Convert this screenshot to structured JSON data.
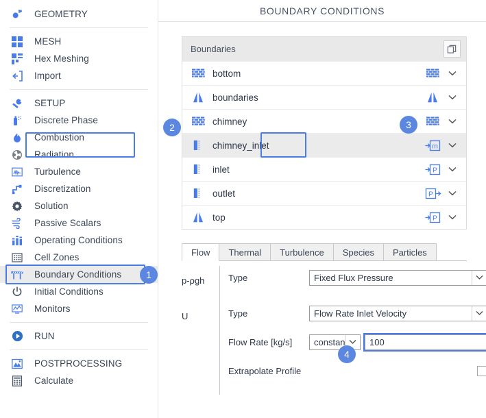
{
  "header": {
    "title": "BOUNDARY CONDITIONS"
  },
  "colors": {
    "accent": "#4a7ce8",
    "badge": "#5b87e0",
    "icon_blue": "#4a7ce8",
    "icon_gray": "#6b7280",
    "panel_header": "#e9e9e9",
    "row_selected": "#ebebeb",
    "text": "#2d3748"
  },
  "sidebar": {
    "groups": [
      {
        "items": [
          {
            "label": "GEOMETRY",
            "icon": "geometry-icon",
            "selected": false
          }
        ]
      },
      {
        "items": [
          {
            "label": "MESH",
            "icon": "mesh-icon",
            "selected": false
          },
          {
            "label": "Hex Meshing",
            "icon": "hex-meshing-icon",
            "selected": false
          },
          {
            "label": "Import",
            "icon": "import-icon",
            "selected": false
          }
        ]
      },
      {
        "items": [
          {
            "label": "SETUP",
            "icon": "wrench-icon",
            "selected": false
          },
          {
            "label": "Discrete Phase",
            "icon": "spray-icon",
            "selected": false
          },
          {
            "label": "Combustion",
            "icon": "flame-icon",
            "selected": false
          },
          {
            "label": "Radiation",
            "icon": "radiation-icon",
            "selected": false
          },
          {
            "label": "Turbulence",
            "icon": "turbulence-icon",
            "selected": false
          },
          {
            "label": "Discretization",
            "icon": "discretization-icon",
            "selected": false
          },
          {
            "label": "Solution",
            "icon": "gear-icon",
            "selected": false
          },
          {
            "label": "Passive Scalars",
            "icon": "wind-icon",
            "selected": false
          },
          {
            "label": "Operating Conditions",
            "icon": "bar-chart-icon",
            "selected": false
          },
          {
            "label": "Cell Zones",
            "icon": "cell-zones-icon",
            "selected": false
          },
          {
            "label": "Boundary Conditions",
            "icon": "boundary-conditions-icon",
            "selected": true
          },
          {
            "label": "Initial Conditions",
            "icon": "power-icon",
            "selected": false
          },
          {
            "label": "Monitors",
            "icon": "monitor-icon",
            "selected": false
          }
        ]
      },
      {
        "items": [
          {
            "label": "RUN",
            "icon": "play-icon",
            "selected": false
          }
        ]
      },
      {
        "items": [
          {
            "label": "POSTPROCESSING",
            "icon": "postprocessing-icon",
            "selected": false
          },
          {
            "label": "Calculate",
            "icon": "calculator-icon",
            "selected": false
          }
        ]
      }
    ]
  },
  "boundaries_panel": {
    "title": "Boundaries",
    "copy_button_icon": "copy-icon",
    "rows": [
      {
        "name": "bottom",
        "left_icon": "wall-brick-icon",
        "type_icon": "wall-brick-icon",
        "chevron": "chevron-down-icon",
        "selected": false
      },
      {
        "name": "boundaries",
        "left_icon": "symmetry-icon",
        "type_icon": "symmetry-icon",
        "chevron": "chevron-down-icon",
        "selected": false
      },
      {
        "name": "chimney",
        "left_icon": "wall-brick-icon",
        "type_icon": "wall-brick-icon",
        "chevron": "chevron-down-icon",
        "selected": false
      },
      {
        "name": "chimney_inlet",
        "left_icon": "patch-icon",
        "type_icon": "mass-flow-in-icon",
        "chevron": "chevron-down-icon",
        "selected": true
      },
      {
        "name": "inlet",
        "left_icon": "patch-icon",
        "type_icon": "pressure-in-icon",
        "chevron": "chevron-down-icon",
        "selected": false
      },
      {
        "name": "outlet",
        "left_icon": "patch-icon",
        "type_icon": "pressure-out-icon",
        "chevron": "chevron-down-icon",
        "selected": false
      },
      {
        "name": "top",
        "left_icon": "symmetry-icon",
        "type_icon": "pressure-in-icon",
        "chevron": "chevron-down-icon",
        "selected": false
      }
    ]
  },
  "tabs": [
    {
      "label": "Flow",
      "selected": true
    },
    {
      "label": "Thermal",
      "selected": false
    },
    {
      "label": "Turbulence",
      "selected": false
    },
    {
      "label": "Species",
      "selected": false
    },
    {
      "label": "Particles",
      "selected": false
    }
  ],
  "form": {
    "pressure": {
      "key": "p-ρgh",
      "type_label": "Type",
      "type_value": "Fixed Flux Pressure"
    },
    "velocity": {
      "key": "U",
      "type_label": "Type",
      "type_value": "Flow Rate Inlet Velocity",
      "flow_rate_label": "Flow Rate [kg/s]",
      "flow_rate_mode": "constant",
      "flow_rate_value": "100",
      "extrapolate_label": "Extrapolate Profile",
      "extrapolate_checked": false
    }
  },
  "callouts": [
    {
      "number": "1",
      "target": "sidebar-item-boundary-conditions"
    },
    {
      "number": "2",
      "target": "boundary-row-chimney_inlet"
    },
    {
      "number": "3",
      "target": "boundary-row-type-icon"
    },
    {
      "number": "4",
      "target": "flow-rate-input"
    }
  ]
}
